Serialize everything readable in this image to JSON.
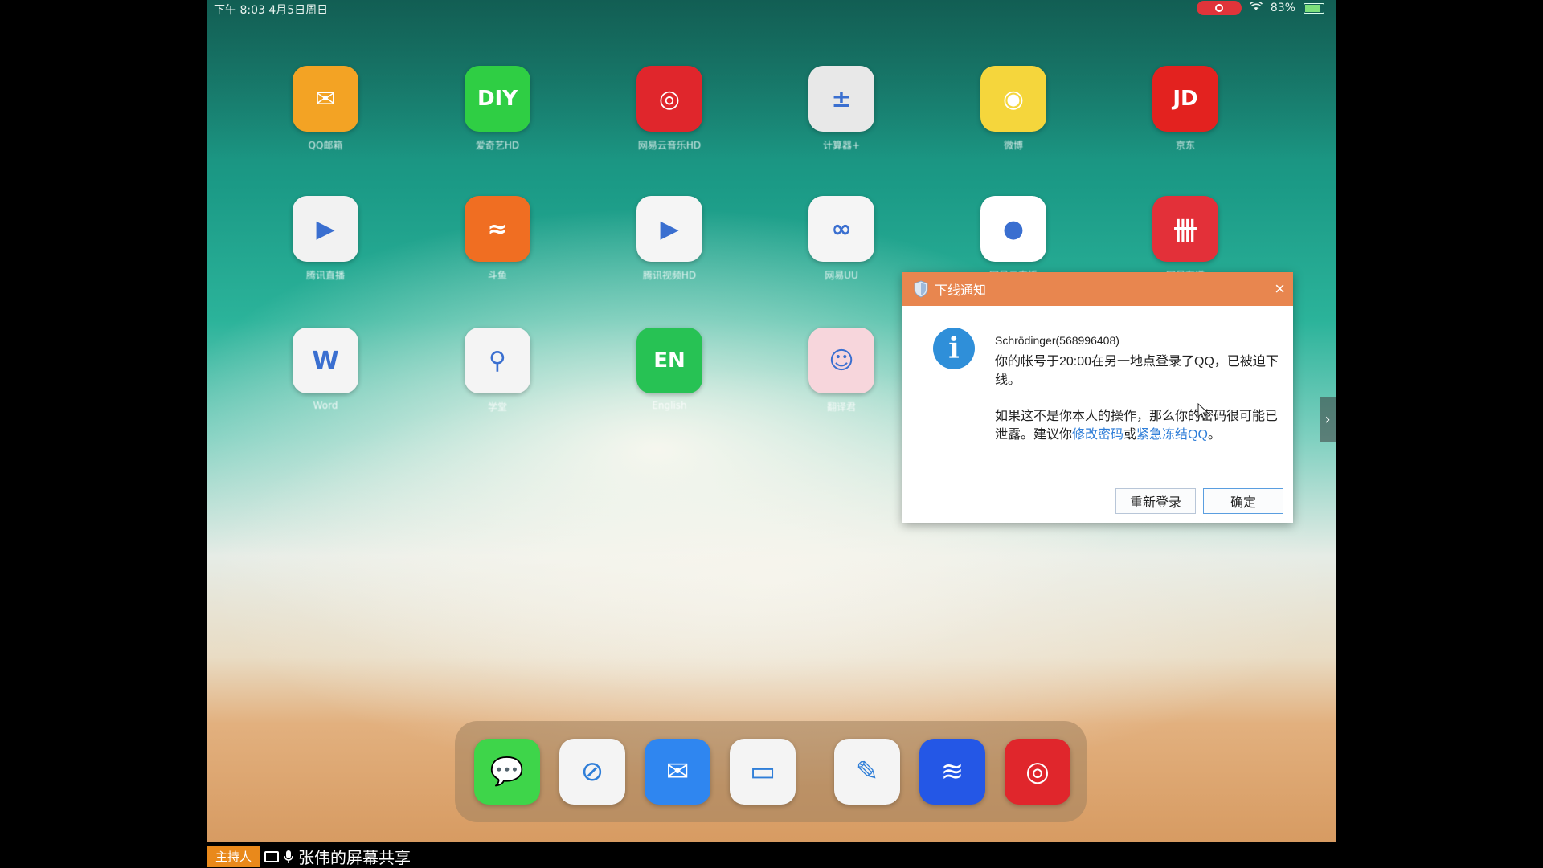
{
  "status_bar": {
    "time_date": "下午 8:03   4月5日周日",
    "battery": "83%"
  },
  "apps": [
    {
      "icon": "mail-envelope-icon",
      "label": "QQ邮箱",
      "color": "#f3a324"
    },
    {
      "icon": "diy-icon",
      "label": "爱奇艺HD",
      "color": "#2fce44"
    },
    {
      "icon": "netease-music-icon",
      "label": "网易云音乐HD",
      "color": "#e0262c"
    },
    {
      "icon": "calculator-icon",
      "label": "计算器+",
      "color": "#e8e8e8"
    },
    {
      "icon": "weibo-icon",
      "label": "微博",
      "color": "#f5d63c"
    },
    {
      "icon": "jd-icon",
      "label": "京东",
      "color": "#e3221f"
    },
    {
      "icon": "video-player-icon",
      "label": "腾讯直播",
      "color": "#f2f2f2"
    },
    {
      "icon": "shark-icon",
      "label": "斗鱼",
      "color": "#f06e22"
    },
    {
      "icon": "tencent-video-icon",
      "label": "腾讯视频HD",
      "color": "#f5f5f5"
    },
    {
      "icon": "link-icon",
      "label": "网易UU",
      "color": "#f5f5f5"
    },
    {
      "icon": "chat-bubble-icon",
      "label": "网易云直播",
      "color": "#ffffff"
    },
    {
      "icon": "red-app-icon",
      "label": "网易有道",
      "color": "#e33039"
    },
    {
      "icon": "word-icon",
      "label": "Word",
      "color": "#f4f4f4"
    },
    {
      "icon": "search-person-icon",
      "label": "学堂",
      "color": "#f4f4f4"
    },
    {
      "icon": "en-icon",
      "label": "English",
      "color": "#27c254"
    },
    {
      "icon": "girl-icon",
      "label": "翻译君",
      "color": "#f7d6dc"
    },
    {
      "icon": "pen-icon",
      "label": "",
      "color": "#ffffff"
    }
  ],
  "dock": [
    {
      "icon": "messages-icon",
      "color": "#3ed54a"
    },
    {
      "icon": "safari-icon",
      "color": "#f4f4f4"
    },
    {
      "icon": "mail-icon",
      "color": "#2f86f0"
    },
    {
      "icon": "files-icon",
      "color": "#f4f4f4"
    },
    {
      "icon": "pen-icon",
      "color": "#f4f4f4"
    },
    {
      "icon": "feishu-icon",
      "color": "#2457e6"
    },
    {
      "icon": "netease-music-icon",
      "color": "#e0262c"
    }
  ],
  "dialog": {
    "title": "下线通知",
    "close": "×",
    "user": "Schrödinger(568996408)",
    "line1": "你的帐号于20:00在另一地点登录了QQ，已被迫下线。",
    "line2_before": "如果这不是你本人的操作，那么你的密码很可能已泄露。建议你",
    "link_change_password": "修改密码",
    "or": "或",
    "link_freeze": "紧急冻结QQ",
    "period": "。",
    "btn_relogin": "重新登录",
    "btn_ok": "确定"
  },
  "share_bar": {
    "host_label": "主持人",
    "title": "张伟的屏幕共享"
  }
}
